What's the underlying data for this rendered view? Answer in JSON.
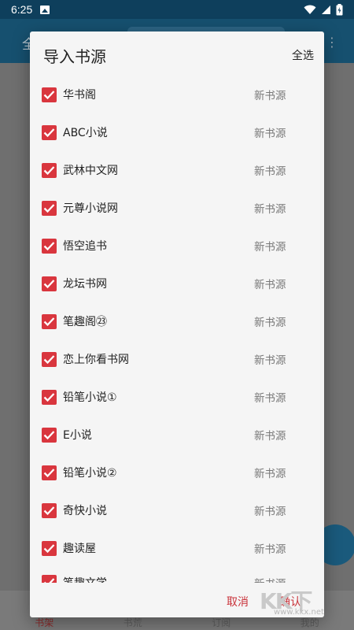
{
  "status_bar": {
    "time": "6:25"
  },
  "background_app": {
    "appbar_title": "全",
    "bottom_nav": [
      "书架",
      "书荒",
      "订阅",
      "我的"
    ]
  },
  "dialog": {
    "title": "导入书源",
    "select_all": "全选",
    "items": [
      {
        "name": "华书阁",
        "tag": "新书源",
        "checked": true
      },
      {
        "name": " ABC小说",
        "tag": "新书源",
        "checked": true
      },
      {
        "name": "武林中文网",
        "tag": "新书源",
        "checked": true
      },
      {
        "name": " 元尊小说网",
        "tag": "新书源",
        "checked": true
      },
      {
        "name": "悟空追书",
        "tag": "新书源",
        "checked": true
      },
      {
        "name": "龙坛书网",
        "tag": "新书源",
        "checked": true
      },
      {
        "name": "笔趣阁㉓",
        "tag": "新书源",
        "checked": true
      },
      {
        "name": "恋上你看书网",
        "tag": "新书源",
        "checked": true
      },
      {
        "name": "铅笔小说①",
        "tag": "新书源",
        "checked": true
      },
      {
        "name": "E小说",
        "tag": "新书源",
        "checked": true
      },
      {
        "name": "铅笔小说②",
        "tag": "新书源",
        "checked": true
      },
      {
        "name": "奇快小说",
        "tag": "新书源",
        "checked": true
      },
      {
        "name": "趣读屋",
        "tag": "新书源",
        "checked": true
      },
      {
        "name": "笔趣文学",
        "tag": "新书源",
        "checked": true
      }
    ],
    "cancel_label": "取消",
    "ok_label": "确认"
  },
  "watermark": {
    "logo": "KK下",
    "url": "www.kkx.net"
  },
  "colors": {
    "accent": "#d9363e",
    "status_bar": "#0e3f5c",
    "dialog_bg": "#f5f5f5"
  }
}
